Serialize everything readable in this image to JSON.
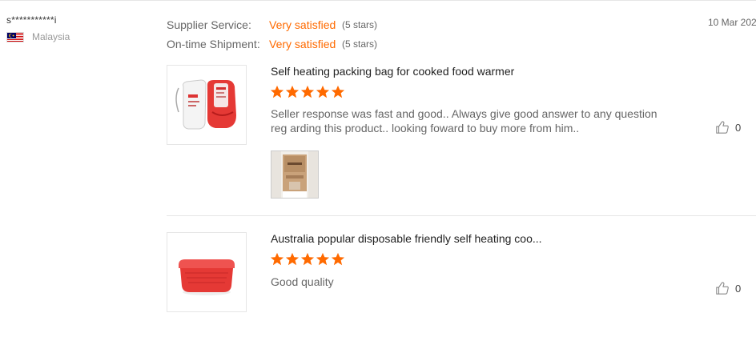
{
  "reviewer": {
    "name": "s***********i",
    "country": "Malaysia",
    "flag_icon": "malaysia-flag-icon"
  },
  "date": "10 Mar 202",
  "ratings": [
    {
      "label": "Supplier Service:",
      "value": "Very satisfied",
      "stars": "(5 stars)"
    },
    {
      "label": "On-time Shipment:",
      "value": "Very satisfied",
      "stars": "(5 stars)"
    }
  ],
  "items": [
    {
      "title": "Self heating packing bag for cooked food warmer",
      "rating": 5,
      "text": "Seller response was fast and good.. Always give good answer to any question reg arding this product.. looking foward to buy more from him..",
      "likes": "0",
      "has_photo": true
    },
    {
      "title": "Australia popular disposable friendly self heating coo...",
      "rating": 5,
      "text": "Good quality",
      "likes": "0",
      "has_photo": false
    }
  ],
  "colors": {
    "accent": "#ff6a00",
    "divider": "#e6e6e6",
    "muted": "#666666"
  },
  "icons": {
    "star": "star-icon",
    "like": "thumbs-up-icon"
  }
}
